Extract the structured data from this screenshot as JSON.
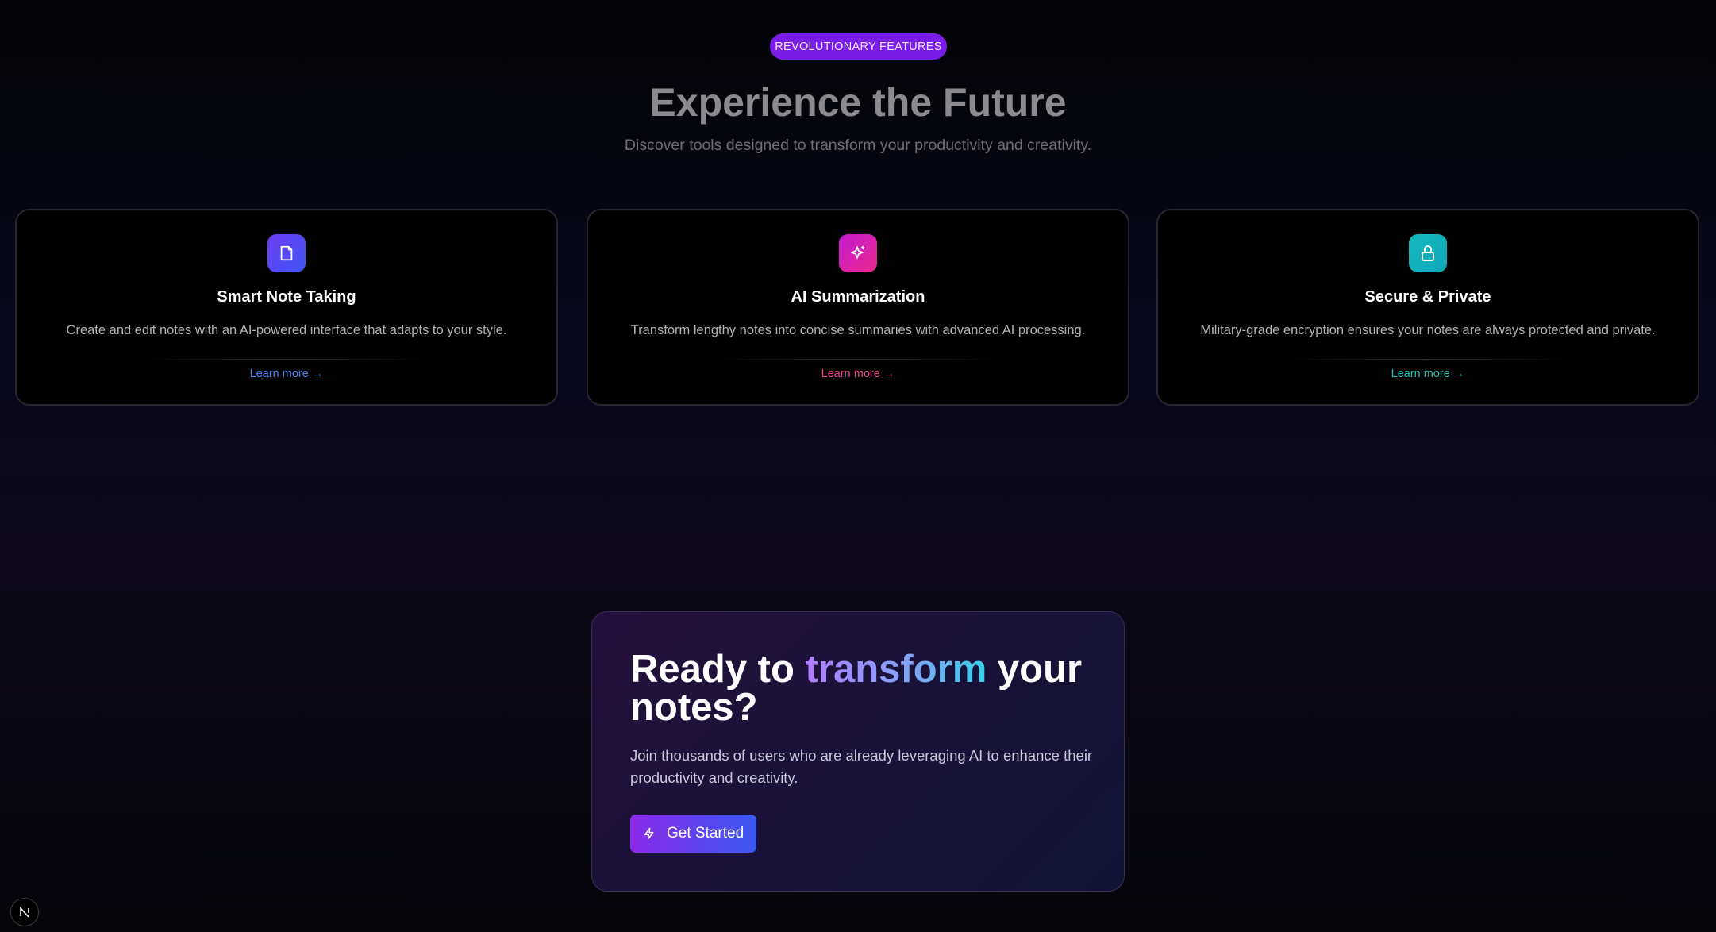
{
  "features": {
    "badge": "REVOLUTIONARY FEATURES",
    "title": "Experience the Future",
    "subtitle": "Discover tools designed to transform your productivity and creativity.",
    "cards": [
      {
        "icon": "note-icon",
        "title": "Smart Note Taking",
        "description": "Create and edit notes with an AI-powered interface that adapts to your style.",
        "link": "Learn more →",
        "accent": "#4a83f2",
        "icon_gradient": [
          "#6d3cf6",
          "#3f56f0"
        ]
      },
      {
        "icon": "sparkles-icon",
        "title": "AI Summarization",
        "description": "Transform lengthy notes into concise summaries with advanced AI processing.",
        "link": "Learn more →",
        "accent": "#ee3f8e",
        "icon_gradient": [
          "#c21bd0",
          "#ec2a8c"
        ]
      },
      {
        "icon": "lock-icon",
        "title": "Secure & Private",
        "description": "Military-grade encryption ensures your notes are always protected and private.",
        "link": "Learn more →",
        "accent": "#1ec3b4",
        "icon_gradient": [
          "#17b8c0",
          "#0ea7b8"
        ]
      }
    ]
  },
  "cta": {
    "heading_before": "Ready to ",
    "heading_highlight": "transform",
    "heading_after": " your notes?",
    "description": "Join thousands of users who are already leveraging AI to enhance their productivity and creativity.",
    "button_label": "Get Started",
    "button_icon": "lightning-icon"
  },
  "footer": {
    "logo": "N"
  }
}
